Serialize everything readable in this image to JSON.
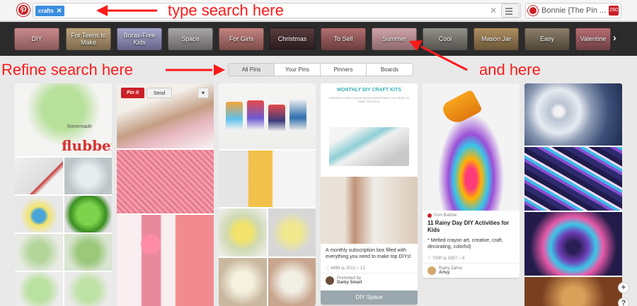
{
  "search": {
    "token": "crafts",
    "token_close": "✕",
    "clear": "✕"
  },
  "profile": {
    "name": "Bonnie {The Pin ...",
    "notifications": "290"
  },
  "annotations": {
    "type_search": "type search here",
    "refine_search": "Refine search here",
    "and_here": "and here",
    "color": "#ff1a1a"
  },
  "categories": [
    "DIY",
    "For Teens to Make",
    "Borax-Free Kids",
    "Space",
    "For Girls",
    "Christmas",
    "To Sell",
    "Summer",
    "Cool",
    "Mason Jar",
    "Easy",
    "Valentine"
  ],
  "category_next": "›",
  "tabs": [
    "All Pins",
    "Your Pins",
    "Pinners",
    "Boards"
  ],
  "pins": {
    "flubber_text": "flubber",
    "flubber_small": "homemade",
    "pinit": "Pin it",
    "send": "Send",
    "heart": "♥",
    "kits_banner": "MONTHLY DIY CRAFT KITS",
    "kits_sub": "A MONTHLY BOX FILLED WITH EVERYTHING YOU NEED TO MAKE TOP DIYS.",
    "kits_desc": "A monthly subscription box filled with everything you need to make top DIYs!",
    "kits_stats": "♡ 4499   ⇆ 2012   ○ 12",
    "kits_promoted": "Promoted by",
    "kits_by": "Darby Smart",
    "babble_source": "from Babble",
    "babble_title": "11 Rainy Day DIY Activities for Kids",
    "babble_desc": "* Melted crayon art, creative, craft, decorating, colorful)",
    "babble_stats": "♡ 7200   ⇆ 1657   ○ 8",
    "babble_user": "Rainy Zahra",
    "babble_board": "Artsy",
    "space_banner": "DIY Space"
  },
  "zoom": {
    "plus": "+",
    "question": "?"
  },
  "colors": {
    "pinterest_red": "#cb2027",
    "token_blue": "#3b8ee0"
  }
}
